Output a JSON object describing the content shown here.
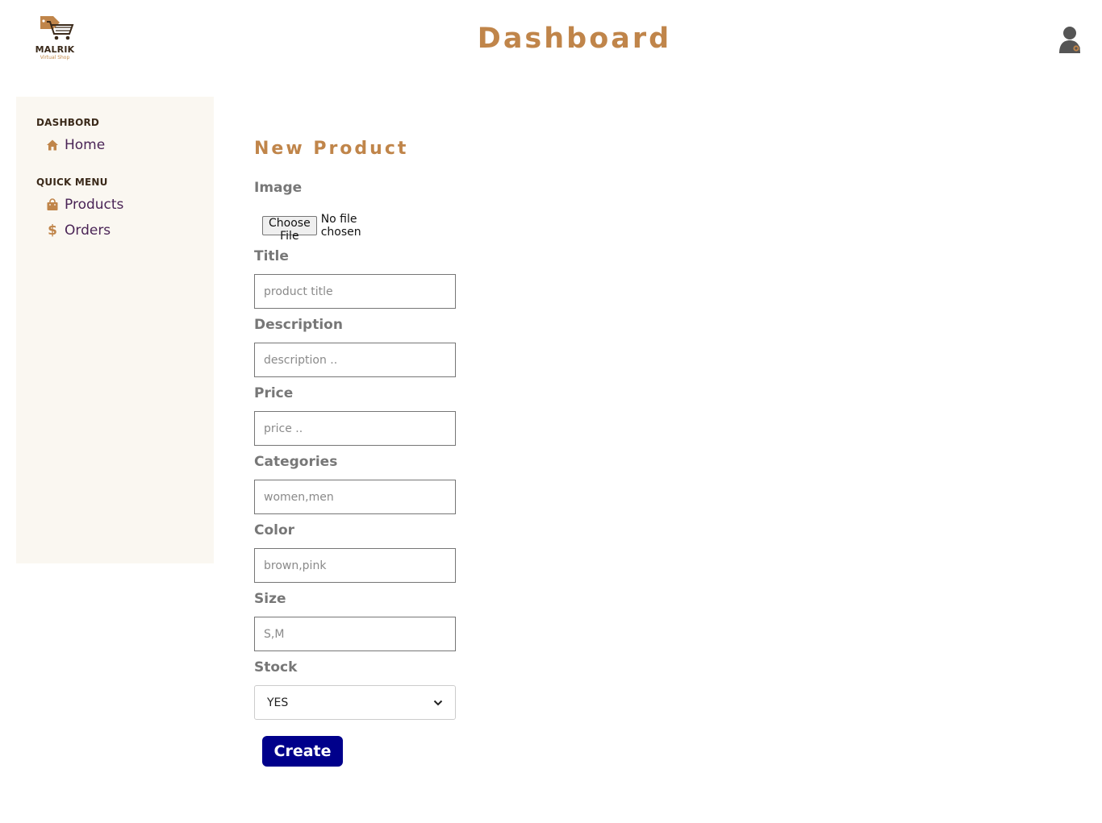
{
  "header": {
    "logo_name": "MALRIK",
    "logo_tagline": "Virtual Shop",
    "title": "Dashboard",
    "brand_color": "#c0854a"
  },
  "sidebar": {
    "sections": [
      {
        "title": "DASHBORD",
        "items": [
          {
            "label": "Home",
            "icon": "home-icon"
          }
        ]
      },
      {
        "title": "QUICK MENU",
        "items": [
          {
            "label": "Products",
            "icon": "shopping-bag-icon"
          },
          {
            "label": "Orders",
            "icon": "dollar-icon"
          }
        ]
      }
    ]
  },
  "form": {
    "title": "New Product",
    "image": {
      "label": "Image",
      "button_label": "Choose File",
      "status": "No file chosen"
    },
    "title_field": {
      "label": "Title",
      "placeholder": "product title"
    },
    "description": {
      "label": "Description",
      "placeholder": "description .."
    },
    "price": {
      "label": "Price",
      "placeholder": "price .."
    },
    "categories": {
      "label": "Categories",
      "placeholder": "women,men"
    },
    "color": {
      "label": "Color",
      "placeholder": "brown,pink"
    },
    "size": {
      "label": "Size",
      "placeholder": "S,M"
    },
    "stock": {
      "label": "Stock",
      "selected": "YES"
    },
    "submit_label": "Create",
    "submit_color": "#00008b"
  }
}
